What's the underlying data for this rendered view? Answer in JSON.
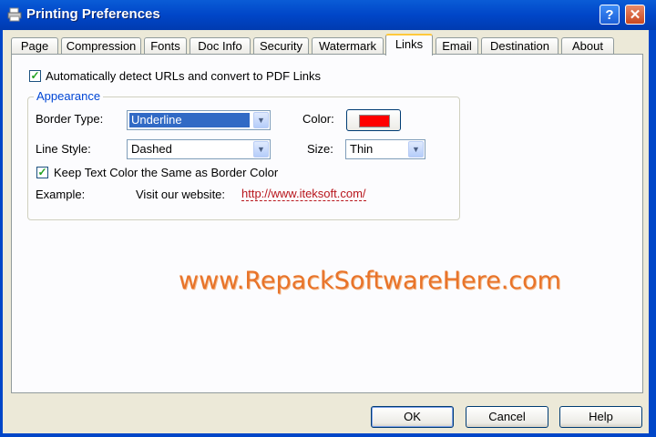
{
  "window": {
    "title": "Printing Preferences",
    "help_label": "?",
    "close_label": "✕"
  },
  "tabs": [
    {
      "label": "Page"
    },
    {
      "label": "Compression"
    },
    {
      "label": "Fonts"
    },
    {
      "label": "Doc Info"
    },
    {
      "label": "Security"
    },
    {
      "label": "Watermark"
    },
    {
      "label": "Links",
      "active": true
    },
    {
      "label": "Email"
    },
    {
      "label": "Destination"
    },
    {
      "label": "About"
    }
  ],
  "links_tab": {
    "auto_detect": {
      "label": "Automatically detect URLs and  convert to PDF Links",
      "checked": true
    },
    "appearance": {
      "title": "Appearance",
      "border_type_label": "Border Type:",
      "border_type_value": "Underline",
      "color_label": "Color:",
      "color_value": "#ff0000",
      "line_style_label": "Line Style:",
      "line_style_value": "Dashed",
      "size_label": "Size:",
      "size_value": "Thin",
      "keep_color": {
        "label": "Keep Text Color the Same as Border Color",
        "checked": true
      },
      "example_label": "Example:",
      "example_text": "Visit our website:",
      "example_link": "http://www.iteksoft.com/"
    }
  },
  "watermark_text": "www.RepackSoftwareHere.com",
  "footer": {
    "ok_label": "OK",
    "cancel_label": "Cancel",
    "help_label": "Help"
  }
}
